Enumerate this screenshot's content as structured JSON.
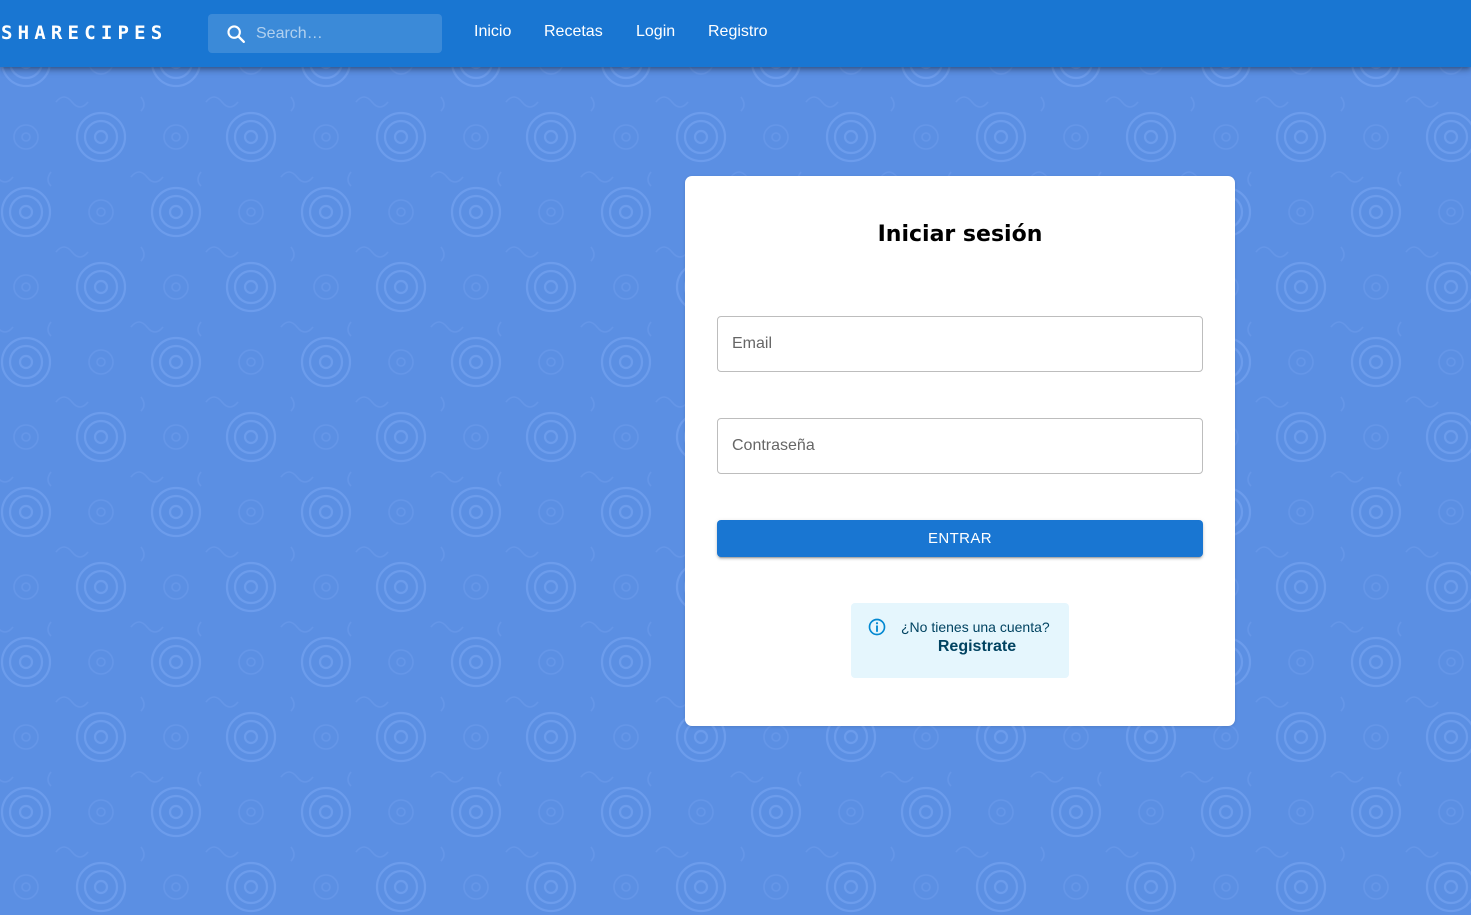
{
  "appbar": {
    "brand": "SHARECIPES",
    "search": {
      "placeholder": "Search…",
      "value": "",
      "icon": "search-icon"
    },
    "nav": [
      "Inicio",
      "Recetas",
      "Login",
      "Registro"
    ],
    "color": "#1976d2"
  },
  "background": {
    "color": "#5b8fe3",
    "pattern_color": "#6b9bea"
  },
  "login": {
    "title": "Iniciar sesión",
    "email": {
      "placeholder": "Email",
      "value": ""
    },
    "password": {
      "placeholder": "Contraseña",
      "value": ""
    },
    "submit_label": "ENTRAR",
    "register_prompt": "¿No tienes una cuenta?",
    "register_link": "Registrate",
    "info_icon": "info-icon",
    "accent_color": "#1976d2",
    "alert_color": "#e5f6fd"
  }
}
